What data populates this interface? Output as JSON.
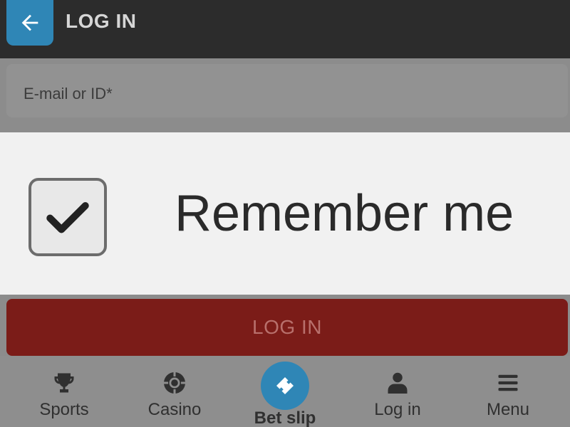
{
  "header": {
    "title": "LOG IN",
    "back_icon": "arrow-left-icon",
    "accent_color": "#2f86b6"
  },
  "form": {
    "email_placeholder": "E-mail or ID*",
    "remember_label": "Remember me",
    "remember_checked": true,
    "login_button_label": "LOG IN",
    "login_button_color": "#7b1c18"
  },
  "bottom_nav": {
    "items": [
      {
        "label": "Sports",
        "icon": "trophy-icon"
      },
      {
        "label": "Casino",
        "icon": "casino-chip-icon"
      },
      {
        "label": "Bet slip",
        "icon": "ticket-icon"
      },
      {
        "label": "Log in",
        "icon": "user-icon"
      },
      {
        "label": "Menu",
        "icon": "hamburger-menu-icon"
      }
    ]
  }
}
